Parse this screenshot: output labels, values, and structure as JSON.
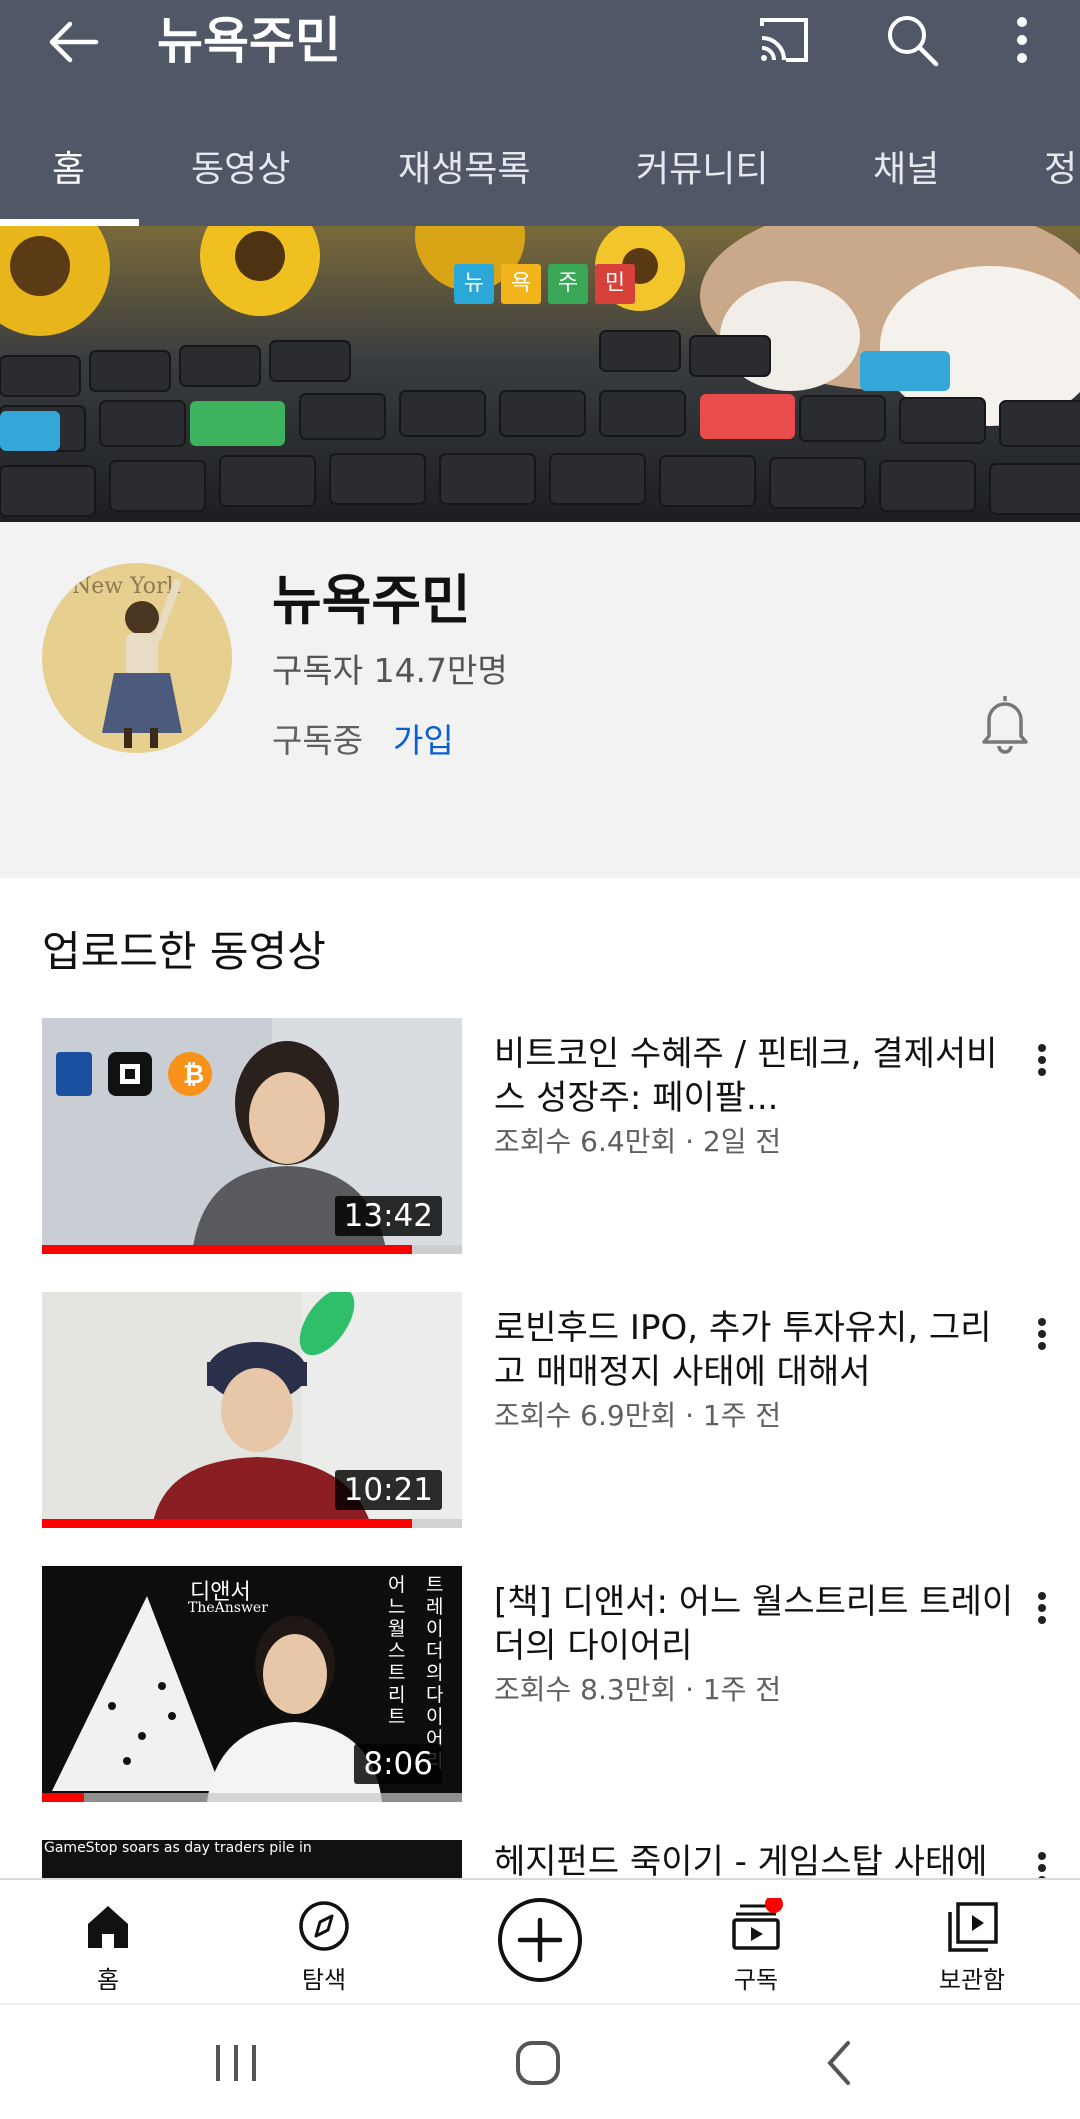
{
  "app_bar": {
    "title": "뉴욕주민",
    "icons": [
      "back-arrow-icon",
      "cast-icon",
      "search-icon",
      "more-vert-icon"
    ]
  },
  "tabs": [
    {
      "label": "홈",
      "active": true
    },
    {
      "label": "동영상"
    },
    {
      "label": "재생목록"
    },
    {
      "label": "커뮤니티"
    },
    {
      "label": "채널"
    },
    {
      "label": "정"
    }
  ],
  "banner": {
    "logo_letters": [
      "뉴",
      "욕",
      "주",
      "민"
    ],
    "logo_colors": [
      "#2aa8d8",
      "#f2b41b",
      "#3aa856",
      "#d8403a"
    ]
  },
  "channel": {
    "name": "뉴욕주민",
    "subscribers": "구독자 14.7만명",
    "status": "구독중",
    "join": "가입",
    "avatar_text": "New York"
  },
  "section_title": "업로드한 동영상",
  "videos": [
    {
      "title": "비트코인 수혜주 / 핀테크, 결제서비스 성장주: 페이팔...",
      "meta": "조회수 6.4만회 · 2일 전",
      "duration": "13:42",
      "progress": 0.88
    },
    {
      "title": "로빈후드 IPO, 추가 투자유치, 그리고 매매정지 사태에 대해서",
      "meta": "조회수 6.9만회 · 1주 전",
      "duration": "10:21",
      "progress": 0.88
    },
    {
      "title": "[책] 디앤서: 어느 월스트리트 트레이더의 다이어리",
      "meta": "조회수 8.3만회 · 1주 전",
      "duration": "8:06",
      "progress": 0.1,
      "thumb_text": {
        "title": "디앤서",
        "subtitle": "TheAnswer",
        "vertical1": "어느 월스트리트",
        "vertical2": "트레이더의 다이어리"
      }
    },
    {
      "title": "헤지펀드 죽이기 - 게임스탑 사태에",
      "meta": "",
      "duration": "",
      "thumb_text": {
        "headline": "GameStop soars as day traders pile in"
      }
    }
  ],
  "bottom_nav": [
    {
      "label": "홈",
      "icon": "home-icon"
    },
    {
      "label": "탐색",
      "icon": "explore-icon"
    },
    {
      "label": "",
      "icon": "create-plus-icon"
    },
    {
      "label": "구독",
      "icon": "subscriptions-icon"
    },
    {
      "label": "보관함",
      "icon": "library-icon"
    }
  ],
  "system_nav": [
    "recents-icon",
    "home-circle-icon",
    "back-chevron-icon"
  ],
  "colors": {
    "app_bar": "#505767",
    "accent_red": "#ff0000",
    "link_blue": "#065fd4"
  }
}
